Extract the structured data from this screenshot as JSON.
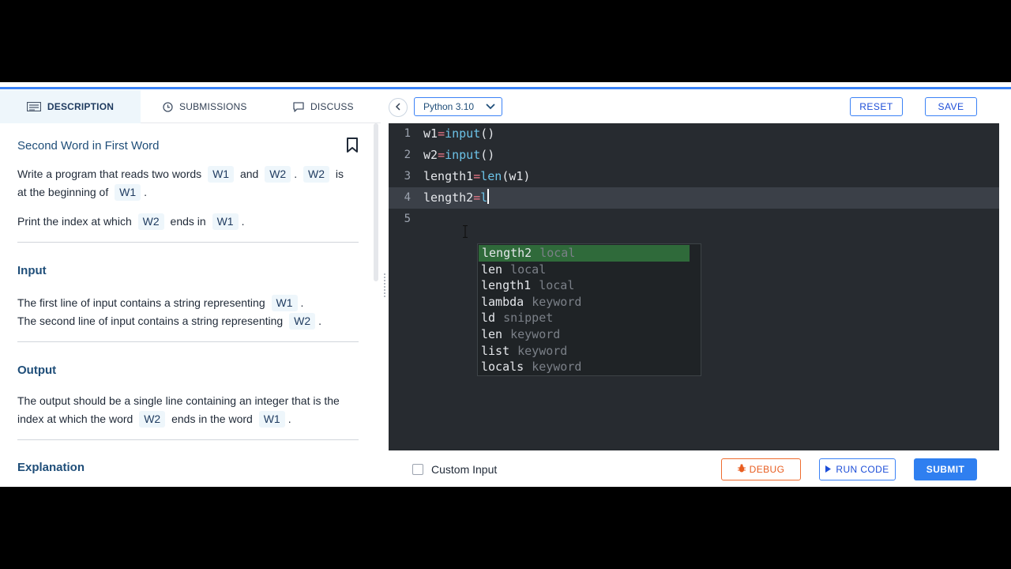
{
  "tabs": [
    {
      "label": "DESCRIPTION",
      "icon": "description-icon",
      "active": true
    },
    {
      "label": "SUBMISSIONS",
      "icon": "clock-icon",
      "active": false
    },
    {
      "label": "DISCUSS",
      "icon": "chat-icon",
      "active": false
    }
  ],
  "problem": {
    "title": "Second Word in First Word",
    "statement": {
      "p1_a": "Write a program that reads two words",
      "w1": "W1",
      "p1_b": "and",
      "w2": "W2",
      "p1_c": ".",
      "p1_d": "is",
      "p1_e": "at the beginning of",
      "p1_f": ".",
      "p2_a": "Print the index at which",
      "p2_b": "ends in",
      "p2_c": "."
    },
    "input_heading": "Input",
    "input_line1": "The first line of input contains a string representing",
    "input_line2": "The second line of input contains a string representing",
    "output_heading": "Output",
    "output_a": "The output should be a single line containing an integer that is the",
    "output_b": "index at which the word",
    "output_c": "ends in the word",
    "explanation_heading": "Explanation"
  },
  "toolbar": {
    "language": "Python 3.10",
    "reset": "RESET",
    "save": "SAVE"
  },
  "editor": {
    "lines": [
      {
        "n": "1",
        "var": "w1",
        "op": "=",
        "fn": "input",
        "rest": "()"
      },
      {
        "n": "2",
        "var": "w2",
        "op": "=",
        "fn": "input",
        "rest": "()"
      },
      {
        "n": "3",
        "var": "length1",
        "op": "=",
        "fn": "len",
        "rest": "(w1)"
      },
      {
        "n": "4",
        "var": "length2",
        "op": "=",
        "fn": "l",
        "rest": ""
      },
      {
        "n": "5"
      }
    ]
  },
  "autocomplete": [
    {
      "name": "length2",
      "kind": "local"
    },
    {
      "name": "len",
      "kind": "local"
    },
    {
      "name": "length1",
      "kind": "local"
    },
    {
      "name": "lambda",
      "kind": "keyword"
    },
    {
      "name": "ld",
      "kind": "snippet"
    },
    {
      "name": "len",
      "kind": "keyword"
    },
    {
      "name": "list",
      "kind": "keyword"
    },
    {
      "name": "locals",
      "kind": "keyword"
    }
  ],
  "bottom": {
    "custom_input": "Custom Input",
    "debug": "DEBUG",
    "run": "RUN CODE",
    "submit": "SUBMIT"
  },
  "colors": {
    "accent": "#3b82f6",
    "debug": "#e85d20",
    "editor_bg": "#272b30",
    "suggest_selected": "#2f6a3a"
  }
}
